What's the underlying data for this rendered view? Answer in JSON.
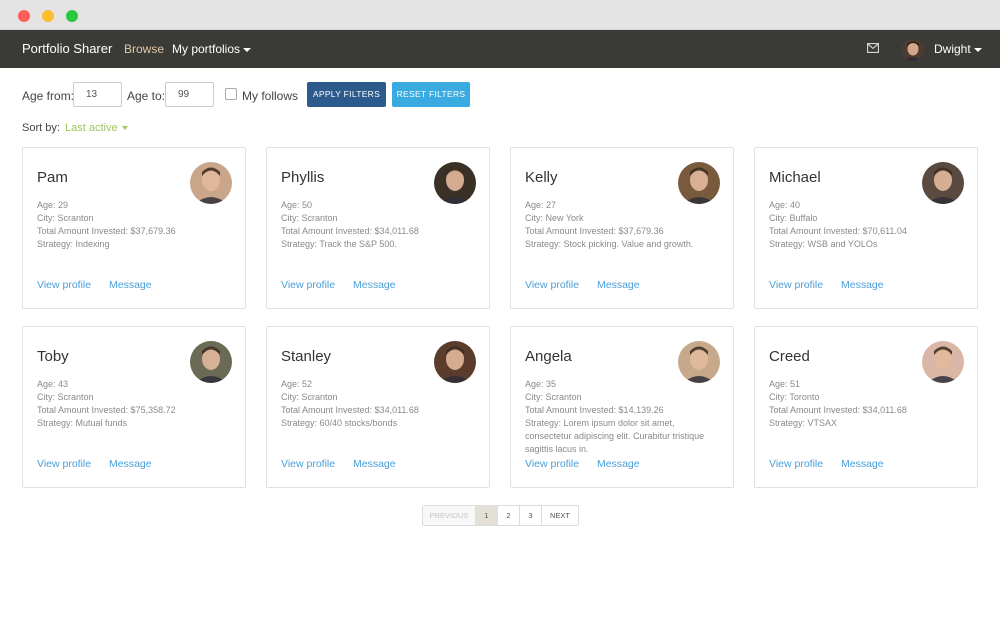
{
  "navbar": {
    "brand": "Portfolio Sharer",
    "browse": "Browse",
    "my_portfolios": "My portfolios",
    "user": "Dwight",
    "mail_icon": "envelope-icon"
  },
  "filters": {
    "age_from_label": "Age from:",
    "age_from_value": "13",
    "age_to_label": "Age to:",
    "age_to_value": "99",
    "my_follows_label": "My follows",
    "apply_label": "APPLY FILTERS",
    "reset_label": "RESET FILTERS",
    "sort_label": "Sort by:",
    "sort_value": "Last active"
  },
  "cards": [
    {
      "name": "Pam",
      "age": "Age: 29",
      "city": "City: Scranton",
      "invested": "Total Amount Invested: $37,679.36",
      "strategy": "Strategy: Indexing",
      "view": "View profile",
      "message": "Message",
      "avatar_color": "#c9a58a"
    },
    {
      "name": "Phyllis",
      "age": "Age: 50",
      "city": "City: Scranton",
      "invested": "Total Amount Invested: $34,011.68",
      "strategy": "Strategy: Track the S&P 500.",
      "view": "View profile",
      "message": "Message",
      "avatar_color": "#3b3026"
    },
    {
      "name": "Kelly",
      "age": "Age: 27",
      "city": "City: New York",
      "invested": "Total Amount Invested: $37,679.36",
      "strategy": "Strategy: Stock picking. Value and growth.",
      "view": "View profile",
      "message": "Message",
      "avatar_color": "#7a5a3d"
    },
    {
      "name": "Michael",
      "age": "Age: 40",
      "city": "City: Buffalo",
      "invested": "Total Amount Invested: $70,611.04",
      "strategy": "Strategy: WSB and YOLOs",
      "view": "View profile",
      "message": "Message",
      "avatar_color": "#5a4a40"
    },
    {
      "name": "Toby",
      "age": "Age: 43",
      "city": "City: Scranton",
      "invested": "Total Amount Invested: $75,358.72",
      "strategy": "Strategy: Mutual funds",
      "view": "View profile",
      "message": "Message",
      "avatar_color": "#6a6a55"
    },
    {
      "name": "Stanley",
      "age": "Age: 52",
      "city": "City: Scranton",
      "invested": "Total Amount Invested: $34,011.68",
      "strategy": "Strategy: 60/40 stocks/bonds",
      "view": "View profile",
      "message": "Message",
      "avatar_color": "#5a3b2c"
    },
    {
      "name": "Angela",
      "age": "Age: 35",
      "city": "City: Scranton",
      "invested": "Total Amount Invested: $14,139.26",
      "strategy": "Strategy: Lorem ipsum dolor sit amet, consectetur adipiscing elit. Curabitur tristique sagittis lacus in.",
      "view": "View profile",
      "message": "Message",
      "avatar_color": "#c6a98a"
    },
    {
      "name": "Creed",
      "age": "Age: 51",
      "city": "City: Toronto",
      "invested": "Total Amount Invested: $34,011.68",
      "strategy": "Strategy: VTSAX",
      "view": "View profile",
      "message": "Message",
      "avatar_color": "#d9b6a5"
    }
  ],
  "pagination": {
    "previous": "PREVIOUS",
    "pages": [
      "1",
      "2",
      "3"
    ],
    "next": "NEXT",
    "current": "1"
  },
  "colors": {
    "navbar": "#3a3a36",
    "apply_button": "#2c5a8c",
    "reset_button": "#3aabe0",
    "link": "#4a9fd8",
    "sort_accent": "#a2c55d"
  }
}
